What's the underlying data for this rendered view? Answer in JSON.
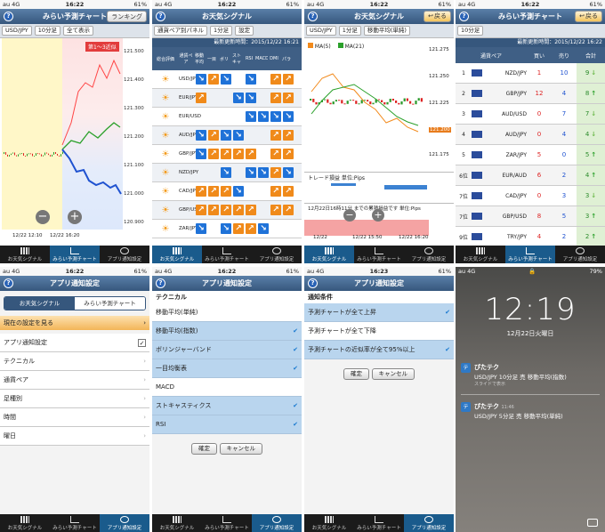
{
  "status": {
    "carrier": "au 4G",
    "time1": "16:22",
    "time3": "16:23",
    "battery": "61%"
  },
  "p1": {
    "title": "みらい予測チャート",
    "nav_btn": "ランキング",
    "pair": "USD/JPY",
    "period": "10分足",
    "view": "全て表示",
    "forecast_tag": "第1〜3近似",
    "yticks": [
      "121.500",
      "121.400",
      "121.300",
      "121.200",
      "121.100",
      "121.000",
      "120.900"
    ],
    "xlabels": [
      "12/22 12:10",
      "12/22 16:20"
    ]
  },
  "p2": {
    "title": "お天気シグナル",
    "view": "通貨ペア別パネル",
    "period": "1分足",
    "setting": "設定",
    "updated": "最新更新時間：2015/12/22 16:21",
    "headers": [
      "総合評価",
      "通貨ペア",
      "移動平均",
      "一目",
      "ボリ",
      "ストキャ",
      "RSI",
      "MACD",
      "DMI",
      "パラ"
    ],
    "pairs": [
      "USD/JPY",
      "EUR/JPY",
      "EUR/USD",
      "AUD/JPY",
      "GBP/JPY",
      "NZD/JPY",
      "CAD/JPY",
      "GBP/USD",
      "ZAR/JPY"
    ],
    "sell": "売"
  },
  "p3": {
    "title": "お天気シグナル",
    "nav_btn": "戻る",
    "pair": "USD/JPY",
    "period": "1分足",
    "indicator": "移動平均(単純)",
    "ma5": "MA(5)",
    "ma21": "MA(21)",
    "yticks": [
      "121.275",
      "121.250",
      "121.225",
      "121.200",
      "121.175"
    ],
    "cur": "121.200",
    "pane1": "トレード損益 単位:Pips",
    "pane2": "12月22日16時11分 までの累積損益です 単位:Pips",
    "xlabels": [
      "12/22",
      "12/22 15:50",
      "12/22 16:20"
    ]
  },
  "p4": {
    "title": "みらい予測チャート",
    "nav_btn": "戻る",
    "period": "10分足",
    "updated": "最新更新時間：2015/12/22 16:22",
    "headers": [
      "通貨ペア",
      "買い",
      "売り",
      "合計"
    ],
    "rows": [
      {
        "rank": "1",
        "pair": "NZD/JPY",
        "buy": "1",
        "sell": "10",
        "total": "9",
        "up": false
      },
      {
        "rank": "2",
        "pair": "GBP/JPY",
        "buy": "12",
        "sell": "4",
        "total": "8",
        "up": true
      },
      {
        "rank": "3",
        "pair": "AUD/USD",
        "buy": "0",
        "sell": "7",
        "total": "7",
        "up": false
      },
      {
        "rank": "4",
        "pair": "AUD/JPY",
        "buy": "0",
        "sell": "4",
        "total": "4",
        "up": false
      },
      {
        "rank": "5",
        "pair": "ZAR/JPY",
        "buy": "5",
        "sell": "0",
        "total": "5",
        "up": true
      },
      {
        "rank": "6位",
        "pair": "EUR/AUD",
        "buy": "6",
        "sell": "2",
        "total": "4",
        "up": true
      },
      {
        "rank": "7位",
        "pair": "CAD/JPY",
        "buy": "0",
        "sell": "3",
        "total": "3",
        "up": false
      },
      {
        "rank": "7位",
        "pair": "GBP/USD",
        "buy": "8",
        "sell": "5",
        "total": "3",
        "up": true
      },
      {
        "rank": "9位",
        "pair": "TRY/JPY",
        "buy": "4",
        "sell": "2",
        "total": "2",
        "up": true
      }
    ]
  },
  "tabs": [
    "お天気シグナル",
    "みらい予測チャート",
    "アプリ通知設定"
  ],
  "p5": {
    "title": "アプリ通知設定",
    "seg": [
      "お天気シグナル",
      "みらい予測チャート"
    ],
    "current": "現在の設定を見る",
    "items": [
      "アプリ通知設定",
      "テクニカル",
      "通貨ペア",
      "足種別",
      "時間",
      "曜日"
    ]
  },
  "p6": {
    "title": "アプリ通知設定",
    "section": "テクニカル",
    "items": [
      {
        "label": "移動平均(単純)",
        "checked": false
      },
      {
        "label": "移動平均(指数)",
        "checked": true
      },
      {
        "label": "ボリンジャーバンド",
        "checked": true
      },
      {
        "label": "一目均衡表",
        "checked": true
      },
      {
        "label": "MACD",
        "checked": false
      },
      {
        "label": "ストキャスティクス",
        "checked": true
      },
      {
        "label": "RSI",
        "checked": true
      }
    ],
    "ok": "確定",
    "cancel": "キャンセル"
  },
  "p7": {
    "title": "アプリ通知設定",
    "section": "通知条件",
    "items": [
      {
        "label": "予測チャートが全て上昇",
        "checked": true
      },
      {
        "label": "予測チャートが全て下降",
        "checked": false
      },
      {
        "label": "予測チャートの近似率が全て95%以上",
        "checked": true
      }
    ],
    "ok": "確定",
    "cancel": "キャンセル"
  },
  "p8": {
    "carrier": "au 4G",
    "battery": "79%",
    "clock": "12:19",
    "date": "12月22日火曜日",
    "notes": [
      {
        "app": "ぴたテク",
        "time": "",
        "line1": "USD/JPY 10分足 売 移動平均(指数)",
        "line2": "スライドで表示"
      },
      {
        "app": "ぴたテク",
        "time": "11:46",
        "line1": "USD/JPY 5分足 売 移動平均(単純)",
        "line2": ""
      }
    ]
  }
}
